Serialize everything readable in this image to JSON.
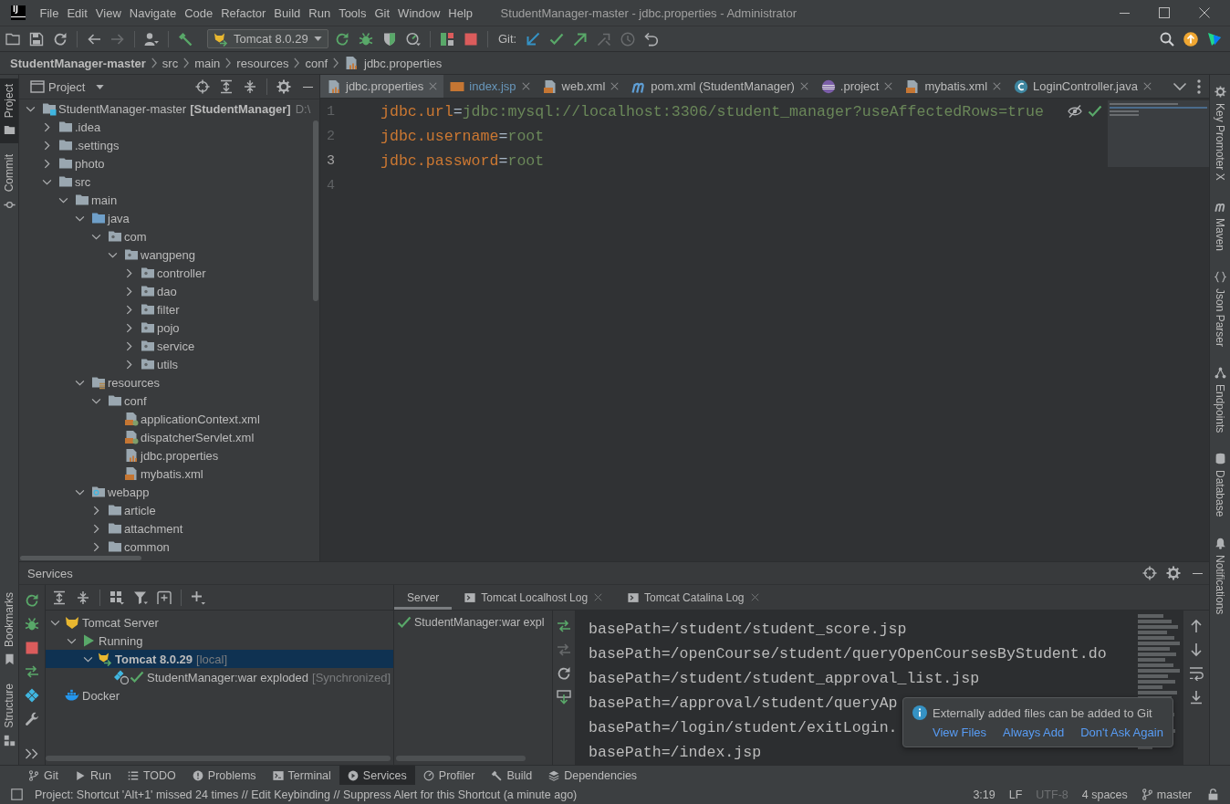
{
  "window": {
    "logo": "IJ",
    "title": "StudentManager-master - jdbc.properties - Administrator"
  },
  "menu": [
    "File",
    "Edit",
    "View",
    "Navigate",
    "Code",
    "Refactor",
    "Build",
    "Run",
    "Tools",
    "Git",
    "Window",
    "Help"
  ],
  "toolbar": {
    "left": [
      {
        "kind": "open",
        "disabled": false
      },
      {
        "kind": "save",
        "disabled": false
      },
      {
        "kind": "sync",
        "disabled": false
      },
      {
        "kind": "back",
        "disabled": false
      },
      {
        "kind": "forward",
        "disabled": true
      },
      {
        "kind": "user",
        "disabled": false
      },
      {
        "kind": "build",
        "disabled": false
      }
    ],
    "run_config": "Tomcat 8.0.29",
    "run": [
      {
        "kind": "rerun",
        "disabled": false
      },
      {
        "kind": "debug",
        "disabled": false
      },
      {
        "kind": "coverage",
        "disabled": false
      },
      {
        "kind": "profile",
        "disabled": false
      },
      {
        "kind": "update_app",
        "disabled": false
      },
      {
        "kind": "stop",
        "disabled": false
      }
    ],
    "git_label": "Git:",
    "git": [
      {
        "kind": "vcs_update",
        "disabled": false
      },
      {
        "kind": "commit",
        "disabled": false
      },
      {
        "kind": "push",
        "disabled": false
      },
      {
        "kind": "history",
        "disabled": true
      },
      {
        "kind": "clock",
        "disabled": true
      },
      {
        "kind": "rollback",
        "disabled": false
      }
    ],
    "right": [
      {
        "kind": "search",
        "disabled": false
      },
      {
        "kind": "ide_update",
        "disabled": false
      },
      {
        "kind": "toolbox",
        "disabled": false
      }
    ]
  },
  "breadcrumbs": [
    {
      "label": "StudentManager-master",
      "kind": "project"
    },
    {
      "label": "src",
      "kind": "folder"
    },
    {
      "label": "main",
      "kind": "folder"
    },
    {
      "label": "resources",
      "kind": "folder"
    },
    {
      "label": "conf",
      "kind": "folder"
    },
    {
      "label": "jdbc.properties",
      "kind": "properties"
    }
  ],
  "left_stripe": {
    "top": [
      {
        "label": "Project",
        "kind": "project",
        "selected": true
      },
      {
        "label": "Commit",
        "kind": "commit",
        "selected": false
      }
    ],
    "bottom": [
      {
        "label": "Bookmarks",
        "kind": "bookmarks",
        "selected": false
      },
      {
        "label": "Structure",
        "kind": "structure",
        "selected": false
      }
    ]
  },
  "project": {
    "title": "Project",
    "tree": [
      {
        "label": "StudentManager-master",
        "module": "[StudentManager]",
        "path": "D:\\",
        "kind": "module",
        "expanded": true,
        "children": [
          {
            "label": ".idea",
            "kind": "folder",
            "expanded": false
          },
          {
            "label": ".settings",
            "kind": "folder",
            "expanded": false
          },
          {
            "label": "photo",
            "kind": "folder",
            "expanded": false
          },
          {
            "label": "src",
            "kind": "folder",
            "expanded": true,
            "children": [
              {
                "label": "main",
                "kind": "folder",
                "expanded": true,
                "children": [
                  {
                    "label": "java",
                    "kind": "source",
                    "expanded": true,
                    "children": [
                      {
                        "label": "com",
                        "kind": "package",
                        "expanded": true,
                        "children": [
                          {
                            "label": "wangpeng",
                            "kind": "package",
                            "expanded": true,
                            "children": [
                              {
                                "label": "controller",
                                "kind": "package",
                                "expanded": false
                              },
                              {
                                "label": "dao",
                                "kind": "package",
                                "expanded": false
                              },
                              {
                                "label": "filter",
                                "kind": "package",
                                "expanded": false
                              },
                              {
                                "label": "pojo",
                                "kind": "package",
                                "expanded": false
                              },
                              {
                                "label": "service",
                                "kind": "package",
                                "expanded": false
                              },
                              {
                                "label": "utils",
                                "kind": "package",
                                "expanded": false
                              }
                            ]
                          }
                        ]
                      }
                    ]
                  },
                  {
                    "label": "resources",
                    "kind": "resources",
                    "expanded": true,
                    "children": [
                      {
                        "label": "conf",
                        "kind": "folder",
                        "expanded": true,
                        "children": [
                          {
                            "label": "applicationContext.xml",
                            "kind": "spring_xml"
                          },
                          {
                            "label": "dispatcherServlet.xml",
                            "kind": "spring_xml"
                          },
                          {
                            "label": "jdbc.properties",
                            "kind": "properties"
                          },
                          {
                            "label": "mybatis.xml",
                            "kind": "xml"
                          }
                        ]
                      }
                    ]
                  },
                  {
                    "label": "webapp",
                    "kind": "web",
                    "expanded": true,
                    "children": [
                      {
                        "label": "article",
                        "kind": "folder",
                        "expanded": false
                      },
                      {
                        "label": "attachment",
                        "kind": "folder",
                        "expanded": false
                      },
                      {
                        "label": "common",
                        "kind": "folder",
                        "expanded": false
                      }
                    ]
                  }
                ]
              }
            ]
          }
        ]
      }
    ]
  },
  "editor": {
    "tabs": [
      {
        "label": "jdbc.properties",
        "kind": "properties",
        "selected": true,
        "modified": false
      },
      {
        "label": "index.jsp",
        "kind": "jsp",
        "selected": false,
        "modified": true
      },
      {
        "label": "web.xml",
        "kind": "xml",
        "selected": false,
        "modified": false
      },
      {
        "label": "pom.xml (StudentManager)",
        "kind": "maven",
        "selected": false,
        "modified": false
      },
      {
        "label": ".project",
        "kind": "eclipse",
        "selected": false,
        "modified": false
      },
      {
        "label": "mybatis.xml",
        "kind": "xml",
        "selected": false,
        "modified": false
      },
      {
        "label": "LoginController.java",
        "kind": "class",
        "selected": false,
        "modified": false
      }
    ],
    "lines": [
      {
        "number": "1",
        "key": "jdbc.url",
        "separator": "=",
        "value": "jdbc:mysql://localhost:3306/student_manager?useAffectedRows=true",
        "current": false
      },
      {
        "number": "2",
        "key": "jdbc.username",
        "separator": "=",
        "value": "root",
        "current": false
      },
      {
        "number": "3",
        "key": "jdbc.password",
        "separator": "=",
        "value": "root",
        "current": true
      },
      {
        "number": "4",
        "current": false
      }
    ]
  },
  "right_stripe": [
    {
      "label": "Key Promoter X",
      "kind": "keypromoter",
      "selected": false
    },
    {
      "label": "Maven",
      "kind": "maven",
      "selected": false
    },
    {
      "label": "Json Parser",
      "kind": "json",
      "selected": false
    },
    {
      "label": "Endpoints",
      "kind": "endpoints",
      "selected": false
    },
    {
      "label": "Database",
      "kind": "database",
      "selected": false
    },
    {
      "label": "Notifications",
      "kind": "notifications",
      "selected": false
    }
  ],
  "services": {
    "title": "Services",
    "actions": [
      {
        "kind": "rerun",
        "disabled": false
      },
      {
        "kind": "debug",
        "disabled": false
      },
      {
        "kind": "stop",
        "disabled": false
      },
      {
        "kind": "deploy",
        "disabled": false
      },
      {
        "kind": "cluster",
        "disabled": false
      },
      {
        "kind": "wrench",
        "disabled": false
      },
      {
        "kind": "more",
        "disabled": false
      }
    ],
    "tree": [
      {
        "label": "Tomcat Server",
        "kind": "server",
        "expanded": true,
        "selected": false,
        "children": [
          {
            "label": "Running",
            "kind": "running",
            "expanded": true,
            "selected": false,
            "children": [
              {
                "label": "Tomcat 8.0.29",
                "note": "[local]",
                "kind": "tomcat",
                "expanded": true,
                "selected": true,
                "children": [
                  {
                    "label": "StudentManager:war exploded",
                    "note": "[Synchronized]",
                    "kind": "artifact",
                    "deployed": true,
                    "selected": false
                  }
                ]
              }
            ]
          }
        ]
      },
      {
        "label": "Docker",
        "kind": "docker",
        "selected": false
      }
    ],
    "tabs": [
      {
        "label": "Server",
        "kind": "server",
        "selected": true
      },
      {
        "label": "Tomcat Localhost Log",
        "kind": "log",
        "selected": false
      },
      {
        "label": "Tomcat Catalina Log",
        "kind": "log",
        "selected": false
      }
    ],
    "deployments": [
      {
        "label": "StudentManager:war expl",
        "deployed": true
      }
    ],
    "deploy_actions": [
      {
        "kind": "deploy",
        "disabled": false
      },
      {
        "kind": "undeploy",
        "disabled": true
      },
      {
        "kind": "refresh",
        "disabled": false
      },
      {
        "kind": "download",
        "disabled": false
      }
    ],
    "console": [
      "basePath=/student/student_score.jsp",
      "basePath=/openCourse/student/queryOpenCoursesByStudent.do",
      "basePath=/student/student_approval_list.jsp",
      "basePath=/approval/student/queryAp",
      "basePath=/login/student/exitLogin.",
      "basePath=/index.jsp"
    ],
    "console_actions": [
      {
        "kind": "up",
        "disabled": false
      },
      {
        "kind": "down",
        "disabled": false
      },
      {
        "kind": "wrap",
        "disabled": false
      },
      {
        "kind": "scroll_end",
        "disabled": false
      }
    ],
    "notification": {
      "message": "Externally added files can be added to Git",
      "actions": [
        "View Files",
        "Always Add",
        "Don't Ask Again"
      ]
    }
  },
  "tool_windows": [
    {
      "label": "Git",
      "kind": "git",
      "selected": false
    },
    {
      "label": "Run",
      "kind": "run",
      "selected": false
    },
    {
      "label": "TODO",
      "kind": "todo",
      "selected": false
    },
    {
      "label": "Problems",
      "kind": "problems",
      "selected": false
    },
    {
      "label": "Terminal",
      "kind": "terminal",
      "selected": false
    },
    {
      "label": "Services",
      "kind": "services",
      "selected": true
    },
    {
      "label": "Profiler",
      "kind": "profiler",
      "selected": false
    },
    {
      "label": "Build",
      "kind": "build",
      "selected": false
    },
    {
      "label": "Dependencies",
      "kind": "dependencies",
      "selected": false
    }
  ],
  "status_bar": {
    "message": "Project: Shortcut 'Alt+1' missed 24 times // Edit Keybinding // Suppress Alert for this Shortcut (a minute ago)",
    "items": [
      {
        "label": "3:19",
        "kind": "text",
        "disabled": false
      },
      {
        "label": "LF",
        "kind": "text",
        "disabled": false
      },
      {
        "label": "UTF-8",
        "kind": "text",
        "disabled": true
      },
      {
        "label": "4 spaces",
        "kind": "text",
        "disabled": false
      },
      {
        "label": "master",
        "kind": "branch",
        "disabled": false
      }
    ]
  }
}
